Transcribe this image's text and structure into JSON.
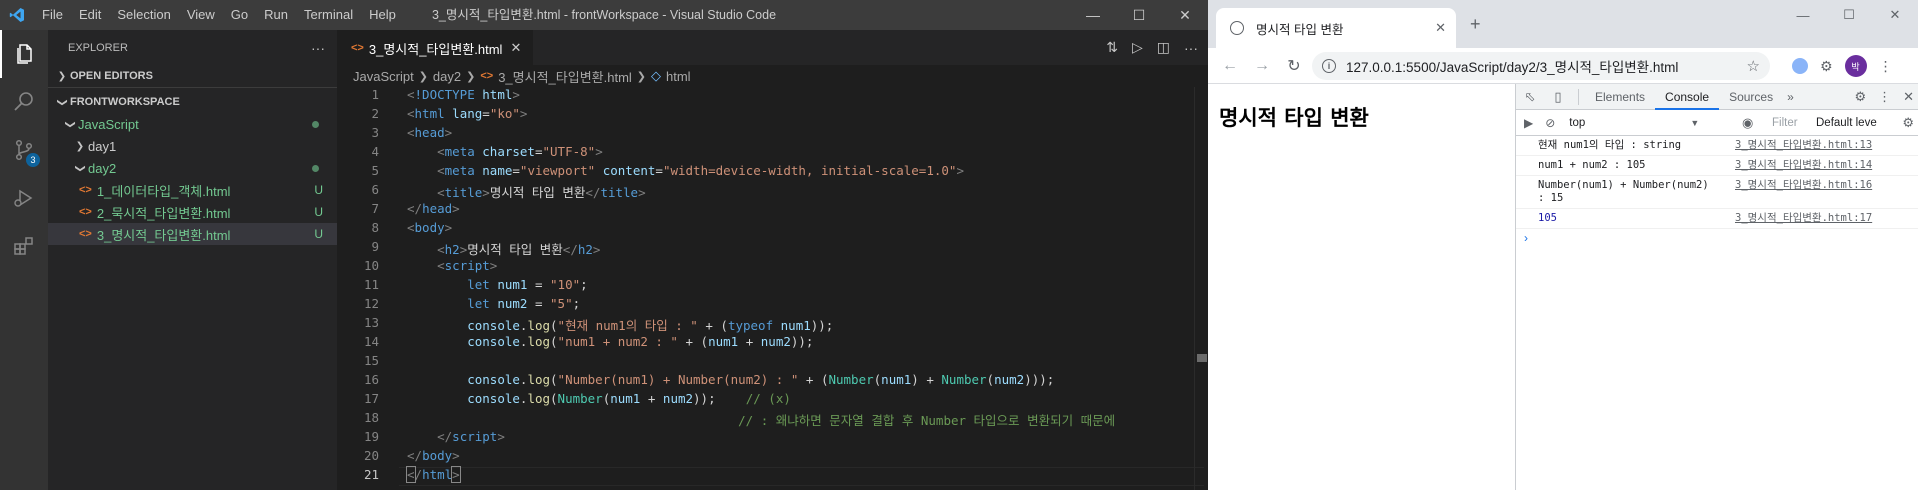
{
  "vscode": {
    "menu": [
      "File",
      "Edit",
      "Selection",
      "View",
      "Go",
      "Run",
      "Terminal",
      "Help"
    ],
    "window_title": "3_명시적_타입변환.html - frontWorkspace - Visual Studio Code",
    "source_control_badge": "3",
    "explorer_title": "EXPLORER",
    "open_editors": "OPEN EDITORS",
    "workspace": "FRONTWORKSPACE",
    "tree": {
      "javascript": "JavaScript",
      "day1": "day1",
      "day2": "day2",
      "files": [
        {
          "name": "1_데이터타입_객체.html",
          "status": "U"
        },
        {
          "name": "2_묵시적_타입변환.html",
          "status": "U"
        },
        {
          "name": "3_명시적_타입변환.html",
          "status": "U"
        }
      ]
    },
    "active_tab": "3_명시적_타입변환.html",
    "breadcrumb": [
      "JavaScript",
      "day2",
      "3_명시적_타입변환.html",
      "html"
    ]
  },
  "browser": {
    "tab_title": "명시적 타입 변환",
    "url": "127.0.0.1:5500/JavaScript/day2/3_명시적_타입변환.html",
    "avatar_initial": "박",
    "page_heading": "명시적 타입 변환",
    "devtools": {
      "tabs": [
        "Elements",
        "Console",
        "Sources"
      ],
      "active_tab": "Console",
      "context": "top",
      "filter_placeholder": "Filter",
      "levels": "Default leve",
      "logs": [
        {
          "message": "현재 num1의 타입 : string",
          "source": "3_명시적_타입변환.html:13"
        },
        {
          "message": "num1 + num2 : 105",
          "source": "3_명시적_타입변환.html:14"
        },
        {
          "message": "Number(num1) + Number(num2) : 15",
          "source": "3_명시적_타입변환.html:16"
        },
        {
          "message": "105",
          "source": "3_명시적_타입변환.html:17"
        }
      ],
      "prompt": "›"
    }
  }
}
